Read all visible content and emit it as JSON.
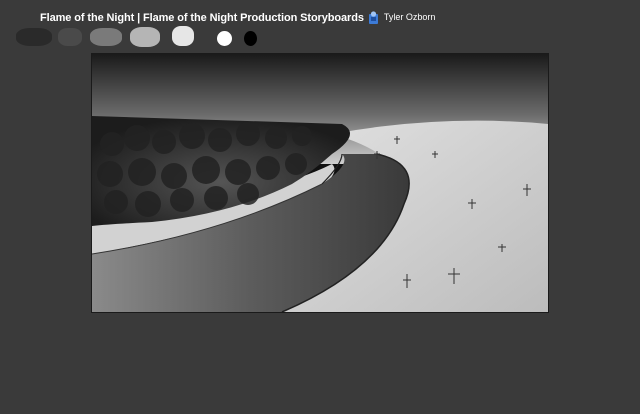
{
  "header": {
    "title": "Flame of the Night | Flame of the Night Production Storyboards",
    "user_name": "Tyler Ozborn"
  },
  "palette": {
    "swatch_colors": [
      "#2a2a2a",
      "#4a4a4a",
      "#7a7a7a",
      "#b5b5b5",
      "#e6e6e6",
      "#ffffff",
      "#000000"
    ]
  },
  "canvas": {
    "icon": "storyboard-panel-river-landscape"
  }
}
